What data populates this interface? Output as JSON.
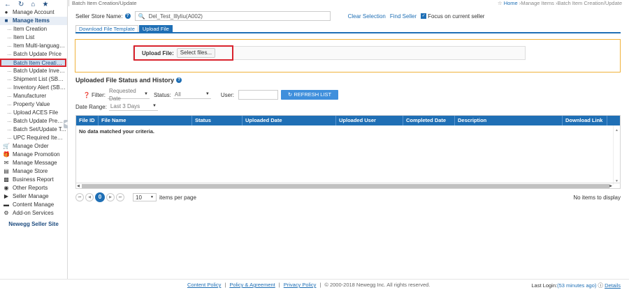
{
  "sidebar": {
    "sections": [
      {
        "label": "Manage Account",
        "icon": "user-icon"
      },
      {
        "label": "Manage Items",
        "icon": "items-icon",
        "active": true
      }
    ],
    "manage_items_children": [
      "Item Creation",
      "Item List",
      "Item Multi-language ...",
      "Batch Update Price",
      "Batch Item Creation...",
      "Batch Update Invent...",
      "Shipment List (SBN ...",
      "Inventory Alert (SBN...",
      "Manufacturer",
      "Property Value",
      "Upload ACES File",
      "Batch Update Premi...",
      "Batch Set/Update T...",
      "UPC Required Item ..."
    ],
    "selected_child_index": 4,
    "bottom_sections": [
      {
        "label": "Manage Order",
        "icon": "cart-icon"
      },
      {
        "label": "Manage Promotion",
        "icon": "gift-icon"
      },
      {
        "label": "Manage Message",
        "icon": "envelope-icon"
      },
      {
        "label": "Manage Store",
        "icon": "store-icon"
      },
      {
        "label": "Business Report",
        "icon": "bar-chart-icon"
      },
      {
        "label": "Other Reports",
        "icon": "report-icon"
      },
      {
        "label": "Seller Manage",
        "icon": "tag-icon"
      },
      {
        "label": "Content Manage",
        "icon": "folder-icon"
      },
      {
        "label": "Add-on Services",
        "icon": "cogs-icon"
      }
    ],
    "brand": "Newegg Seller Site"
  },
  "breadcrumb": {
    "page": "Batch Item Creation/Update",
    "home": "Home",
    "sep1": "›Manage Items",
    "sep2": "›Batch Item Creation/Update"
  },
  "store": {
    "label": "Seller Store Name:",
    "value": "Del_Test_Illyliu(A002)",
    "clear_selection": "Clear Selection",
    "find_seller": "Find Seller",
    "focus_label": "Focus on current seller",
    "focus_checked": true
  },
  "tabs": [
    {
      "label": "Download File Template",
      "active": false
    },
    {
      "label": "Upload File",
      "active": true
    }
  ],
  "upload": {
    "label": "Upload File:",
    "button": "Select files..."
  },
  "history": {
    "title": "Uploaded File Status and History",
    "filter_label": "Filter:",
    "filter_value": "Requested Date",
    "status_label": "Status:",
    "status_value": "All",
    "user_label": "User:",
    "user_value": "",
    "refresh_button": "REFRESH LIST",
    "date_range_label": "Date Range:",
    "date_range_value": "Last 3 Days"
  },
  "grid": {
    "columns": [
      "File ID",
      "File Name",
      "Status",
      "Uploaded Date",
      "Uploaded User",
      "Completed Date",
      "Description",
      "Download Link"
    ],
    "empty_message": "No data matched your criteria."
  },
  "pager": {
    "current_page": "0",
    "page_size": "10",
    "items_per_page": "items per page",
    "no_items": "No items to display"
  },
  "footer": {
    "content_policy": "Content Policy",
    "policy_agreement": "Policy & Agreement",
    "privacy_policy": "Privacy Policy",
    "copyright": "© 2000-2018 Newegg Inc. All rights reserved.",
    "last_login_label": "Last Login:",
    "last_login_value": "(53 minutes ago)",
    "details": "Details"
  }
}
